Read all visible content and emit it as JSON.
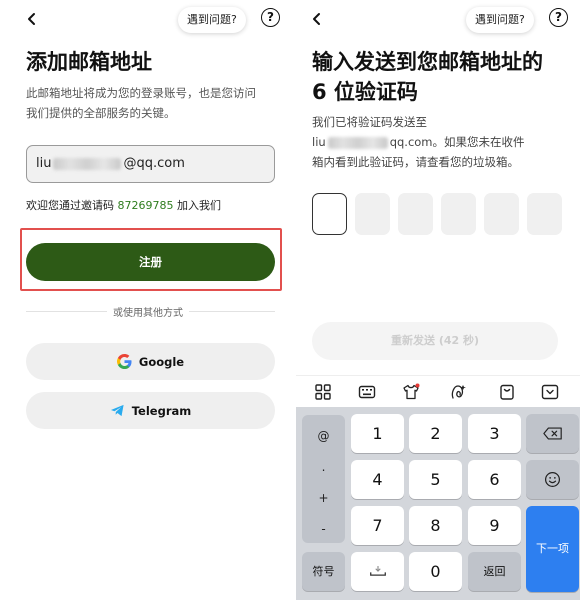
{
  "left": {
    "help_label": "遇到问题?",
    "help_icon": "?",
    "title": "添加邮箱地址",
    "desc_line1": "此邮箱地址将成为您的登录账号，也是您访问",
    "desc_line2": "我们提供的全部服务的关键。",
    "email_prefix": "liu",
    "email_suffix": "@qq.com",
    "invite_text": "欢迎您通过邀请码",
    "invite_code": "87269785",
    "invite_suffix": "加入我们",
    "register_label": "注册",
    "divider_label": "或使用其他方式",
    "google_label": "Google",
    "telegram_label": "Telegram"
  },
  "right": {
    "help_label": "遇到问题?",
    "help_icon": "?",
    "title_line1": "输入发送到您邮箱地址的",
    "title_line2": "6 位验证码",
    "desc_line1": "我们已将验证码发送至",
    "desc_email_prefix": "liu",
    "desc_email_suffix": "qq.com。如果您未在收件",
    "desc_line3": "箱内看到此验证码，请查看您的垃圾箱。",
    "resend_label": "重新发送 (42 秒)",
    "toolbar_icons": [
      "grid-icon",
      "keyboard-icon",
      "shirt-icon",
      "handwriting-icon",
      "clipboard-icon",
      "collapse-keyboard-icon"
    ],
    "keyboard": {
      "symbols": [
        "@",
        ".",
        "+",
        "-"
      ],
      "rows": [
        [
          "1",
          "2",
          "3"
        ],
        [
          "4",
          "5",
          "6"
        ],
        [
          "7",
          "8",
          "9"
        ]
      ],
      "symbol_key": "符号",
      "zero": "0",
      "return_key": "返回",
      "next_key": "下一项"
    }
  },
  "colors": {
    "primary_green": "#2d5a16",
    "invite_code_green": "#2f7d1f",
    "highlight_red": "#e2504e",
    "next_key_blue": "#2d7ff0"
  }
}
